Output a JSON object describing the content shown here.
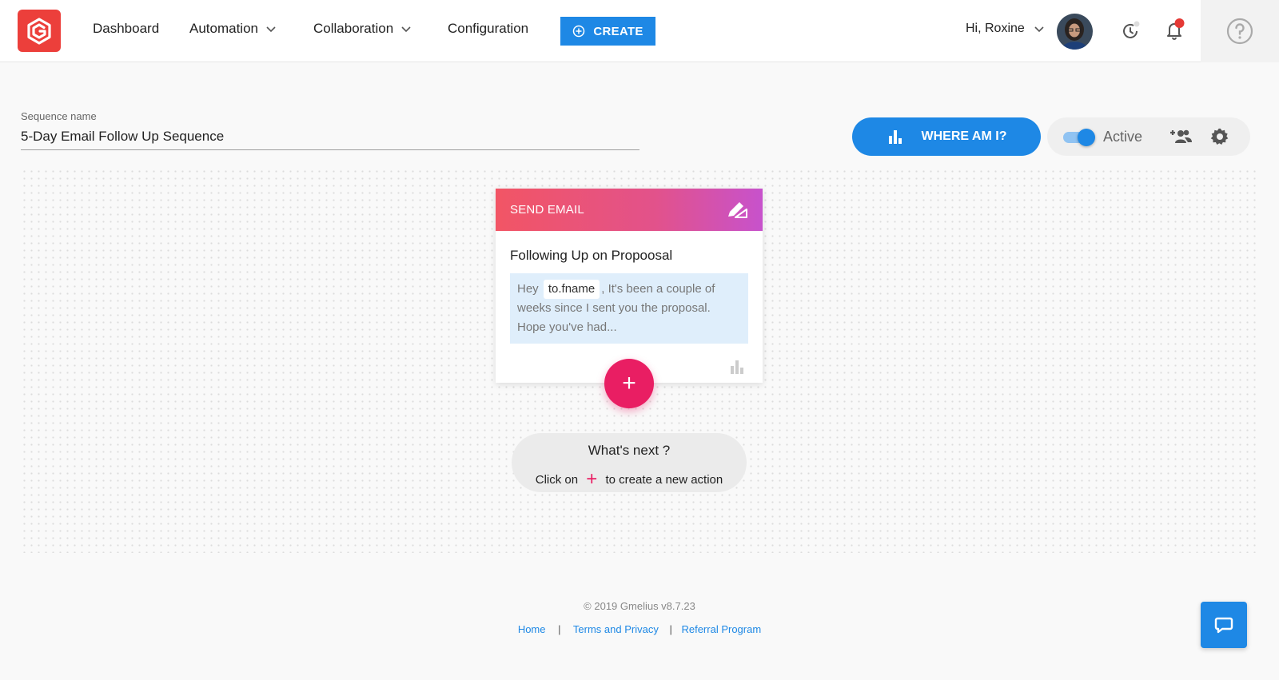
{
  "header": {
    "nav": {
      "dashboard": "Dashboard",
      "automation": "Automation",
      "collaboration": "Collaboration",
      "configuration": "Configuration"
    },
    "create_label": "CREATE",
    "greeting": "Hi, Roxine"
  },
  "sequence": {
    "label": "Sequence name",
    "value": "5-Day Email Follow Up Sequence"
  },
  "toolbar": {
    "where_label": "WHERE AM I?",
    "active_label": "Active",
    "active_on": true
  },
  "card": {
    "header": "SEND EMAIL",
    "title": "Following Up on Propoosal",
    "body_prefix": "Hey",
    "chip": "to.fname",
    "body_rest": ",  It's been a couple of weeks since I sent you the proposal. Hope you've had..."
  },
  "add_button": "+",
  "next": {
    "title": "What's next ?",
    "sub_before": "Click on",
    "sub_plus": "+",
    "sub_after": "to create a new action"
  },
  "footer": {
    "copyright": "© 2019 Gmelius v8.7.23",
    "links": [
      "Home",
      "Terms and Privacy",
      "Referral Program"
    ],
    "separator": "|"
  },
  "colors": {
    "primary": "#1e88e5",
    "brand_red": "#ec3f3b",
    "accent_pink": "#e91e63"
  },
  "icons": [
    "gmelius-logo-icon",
    "chevron-down-icon",
    "plus-circle-icon",
    "history-icon",
    "bell-icon",
    "help-icon",
    "bar-chart-icon",
    "add-people-icon",
    "gear-icon",
    "edit-icon",
    "chat-icon"
  ]
}
